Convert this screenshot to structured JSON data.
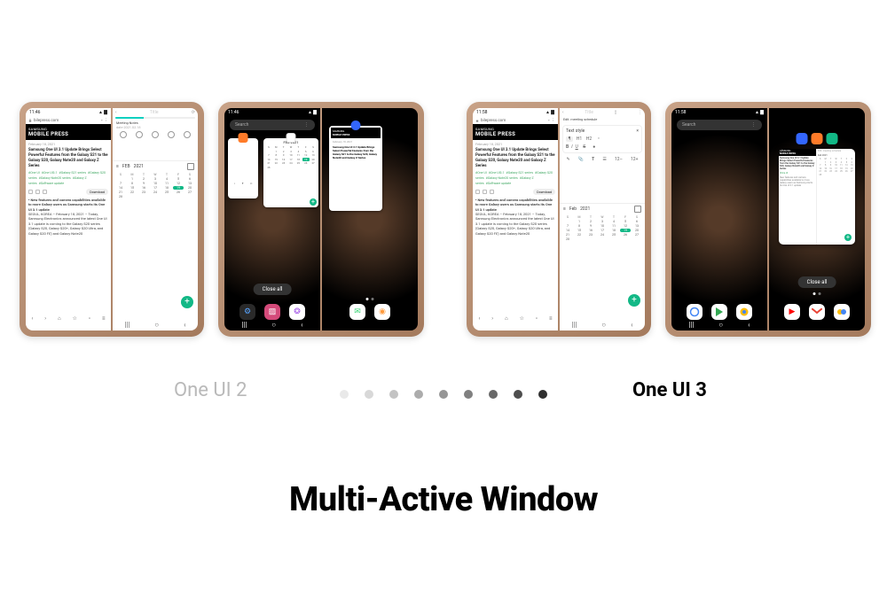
{
  "title": "Multi-Active Window",
  "labelLeft": "One UI 2",
  "labelRight": "One UI 3",
  "dotShades": [
    "#e9e9e9",
    "#d8d8d8",
    "#c3c3c3",
    "#acacac",
    "#969696",
    "#808080",
    "#686868",
    "#4e4e4e",
    "#2f2f2f"
  ],
  "statusTimes": {
    "dev1": "11:46",
    "dev2": "11:46",
    "dev3": "11:58",
    "dev4": "11:58"
  },
  "browser": {
    "url": "bilepress.com",
    "brand": "SAMSUNG",
    "product": "MOBILE PRESS",
    "date": "February 18, 2021",
    "headline": "Samsung One UI 3.1 Update Brings Select Powerful Features from the Galaxy S21 to the Galaxy S20, Galaxy Note20 and Galaxy Z Series",
    "tags": [
      "#One UI",
      "#One UI3.1",
      "#Galaxy S21 series",
      "#Galaxy S20 series",
      "#Galaxy Note20 series",
      "#Galaxy Z series",
      "#Software update"
    ],
    "download": "Download",
    "summary": "New features and camera capabilities available to more Galaxy users as Samsung starts its One UI 3.1 update",
    "body": "SEOUL, KOREA – February 18, 2021 – Today, Samsung Electronics announced the latest One UI 3.1 update is coming to the Galaxy S20 series (Galaxy S20, Galaxy S20+, Galaxy S20 Ultra, and Galaxy S20 FE) and Galaxy Note20"
  },
  "notes": {
    "back": "‹",
    "titlePlaceholder": "Title",
    "meetingTitle": "Meeting Notes",
    "meetingDate": "date 2021.02.18",
    "editTitle": "Edit. meeting schedule",
    "textStyle": "Text style",
    "close": "×",
    "sizeDown": "12–",
    "sizeUp": "12+"
  },
  "calendar": {
    "monthArrow": "‹",
    "monthLabel": "FEB",
    "monthLabelMixed": "Feb",
    "year": "2021",
    "days": [
      "S",
      "M",
      "T",
      "W",
      "T",
      "F",
      "S"
    ],
    "cells": [
      "",
      "1",
      "2",
      "3",
      "4",
      "5",
      "6",
      "7",
      "8",
      "9",
      "10",
      "11",
      "12",
      "13",
      "14",
      "15",
      "16",
      "17",
      "18",
      "19",
      "20",
      "21",
      "22",
      "23",
      "24",
      "25",
      "26",
      "27",
      "28",
      "",
      "",
      "",
      "",
      "",
      ""
    ],
    "today": "19",
    "fab": "+"
  },
  "recents": {
    "searchPlaceholder": "Search",
    "closeAll": "Close all"
  },
  "nav": {
    "recents": "|||",
    "home": "○",
    "back": "‹"
  },
  "dock2": [
    "settings",
    "gallery",
    "shop",
    "msg",
    "int"
  ],
  "dock4": [
    "google",
    "play",
    "chrome",
    "yt",
    "gmail",
    "photos"
  ]
}
